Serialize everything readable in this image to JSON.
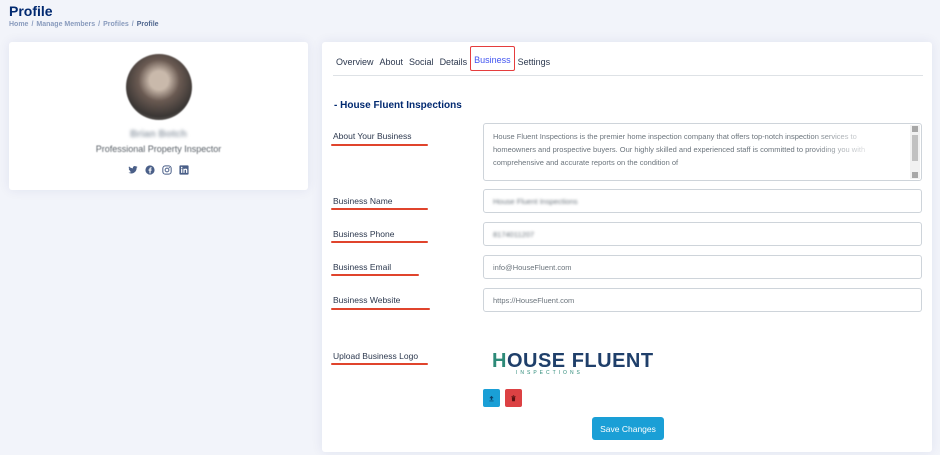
{
  "page": {
    "title": "Profile",
    "breadcrumb": [
      "Home",
      "Manage Members",
      "Profiles",
      "Profile"
    ]
  },
  "profile_card": {
    "name": "Brian Botch",
    "role": "Professional Property Inspector",
    "socials": [
      "twitter-icon",
      "facebook-icon",
      "instagram-icon",
      "linkedin-icon"
    ]
  },
  "tabs": [
    {
      "label": "Overview"
    },
    {
      "label": "About"
    },
    {
      "label": "Social"
    },
    {
      "label": "Details"
    },
    {
      "label": "Business",
      "active": true
    },
    {
      "label": "Settings"
    }
  ],
  "business": {
    "section_title": "- House Fluent Inspections",
    "about_label": "About Your Business",
    "about_value": "House Fluent Inspections is the premier home inspection company that offers top-notch inspection services to homeowners and prospective buyers. Our highly skilled and experienced staff is committed to providing you with comprehensive and accurate reports on the condition of",
    "name_label": "Business Name",
    "name_value": "House Fluent Inspections",
    "phone_label": "Business Phone",
    "phone_value": "8174011207",
    "email_label": "Business Email",
    "email_value": "info@HouseFluent.com",
    "website_label": "Business Website",
    "website_value": "https://HouseFluent.com",
    "logo_label": "Upload Business Logo",
    "logo_text_main": "HOUSE FLUENT",
    "logo_text_sub": "INSPECTIONS",
    "save_label": "Save Changes"
  },
  "colors": {
    "accent": "#4154f1",
    "button": "#1a9fd6",
    "danger": "#dc4143",
    "annotation": "#e0442c"
  }
}
